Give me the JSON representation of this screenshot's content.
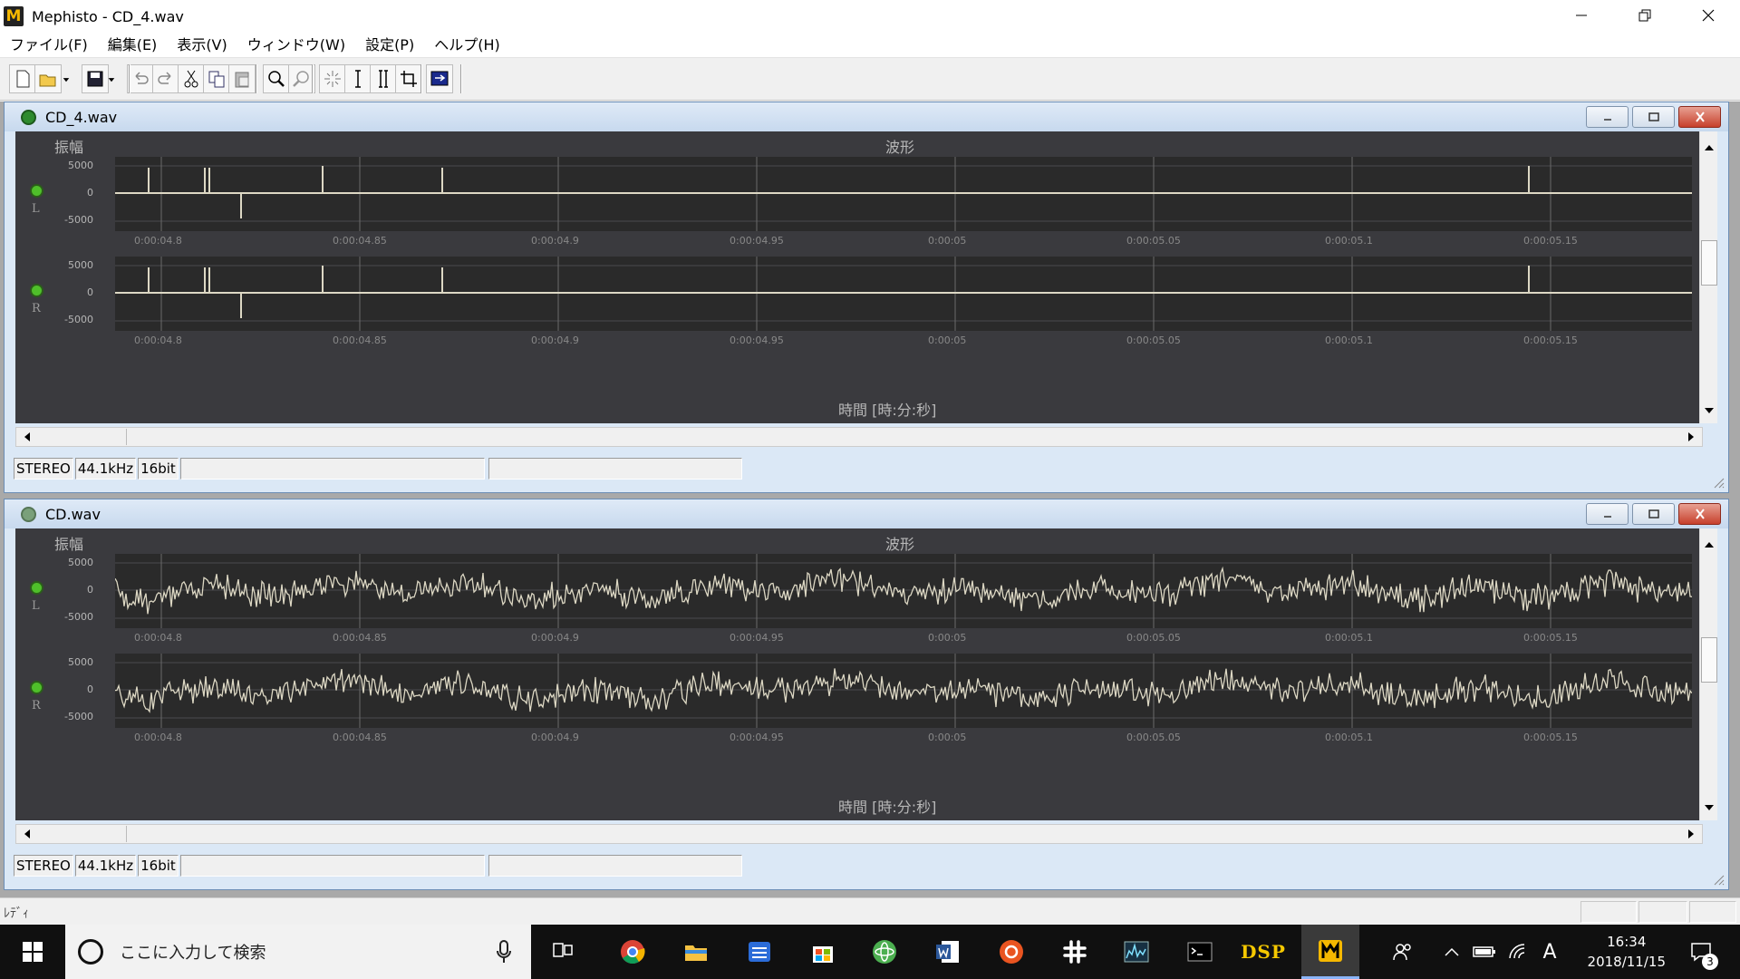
{
  "window": {
    "title": "Mephisto - CD_4.wav",
    "app_icon": "M"
  },
  "menu": [
    "ファイル(F)",
    "編集(E)",
    "表示(V)",
    "ウィンドウ(W)",
    "設定(P)",
    "ヘルプ(H)"
  ],
  "toolbar_icons": [
    "new-file-icon",
    "open-folder-icon",
    "dropdown-arrow-icon",
    "save-icon",
    "dropdown-arrow-icon",
    "undo-icon",
    "redo-icon",
    "cut-icon",
    "copy-icon",
    "paste-icon",
    "zoom-in-icon",
    "zoom-out-icon",
    "select-all-icon",
    "cursor-icon",
    "range-icon",
    "crop-icon",
    "monitor-icon"
  ],
  "windows": [
    {
      "name": "CD_4.wav",
      "plot_title": "波形",
      "ylabel": "振幅",
      "xlabel": "時間 [時:分:秒]",
      "y_ticks": [
        "5000",
        "0",
        "-5000"
      ],
      "x_ticks": [
        "0:00:04.8",
        "0:00:04.85",
        "0:00:04.9",
        "0:00:04.95",
        "0:00:05",
        "0:00:05.05",
        "0:00:05.1",
        "0:00:05.15"
      ],
      "channels": [
        "L",
        "R"
      ],
      "signal": "impulses",
      "status": [
        "STEREO",
        "44.1kHz",
        "16bit"
      ]
    },
    {
      "name": "CD.wav",
      "plot_title": "波形",
      "ylabel": "振幅",
      "xlabel": "時間 [時:分:秒]",
      "y_ticks": [
        "5000",
        "0",
        "-5000"
      ],
      "x_ticks": [
        "0:00:04.8",
        "0:00:04.85",
        "0:00:04.9",
        "0:00:04.95",
        "0:00:05",
        "0:00:05.05",
        "0:00:05.1",
        "0:00:05.15"
      ],
      "channels": [
        "L",
        "R"
      ],
      "signal": "noise",
      "status": [
        "STEREO",
        "44.1kHz",
        "16bit"
      ]
    }
  ],
  "statusbar": {
    "text": "ﾚﾃﾞｨ"
  },
  "taskbar": {
    "search_placeholder": "ここに入力して検索",
    "apps": [
      "task-view-icon",
      "chrome-icon",
      "file-explorer-icon",
      "calendar-app-icon",
      "store-icon",
      "atom-icon",
      "word-icon",
      "ubuntu-icon",
      "slack-icon",
      "spectrum-app-icon",
      "terminal-icon",
      "dsp-app-icon",
      "mephisto-app-icon"
    ],
    "dsp_label": "DSP",
    "ime": "A",
    "time": "16:34",
    "date": "2018/11/15",
    "notification_count": "3"
  },
  "colors": {
    "plot_bg": "#3a3a3e",
    "trace_bg": "#2a2a2a",
    "wave": "#ddd8c4",
    "active_dot": "#4fbf2a"
  }
}
